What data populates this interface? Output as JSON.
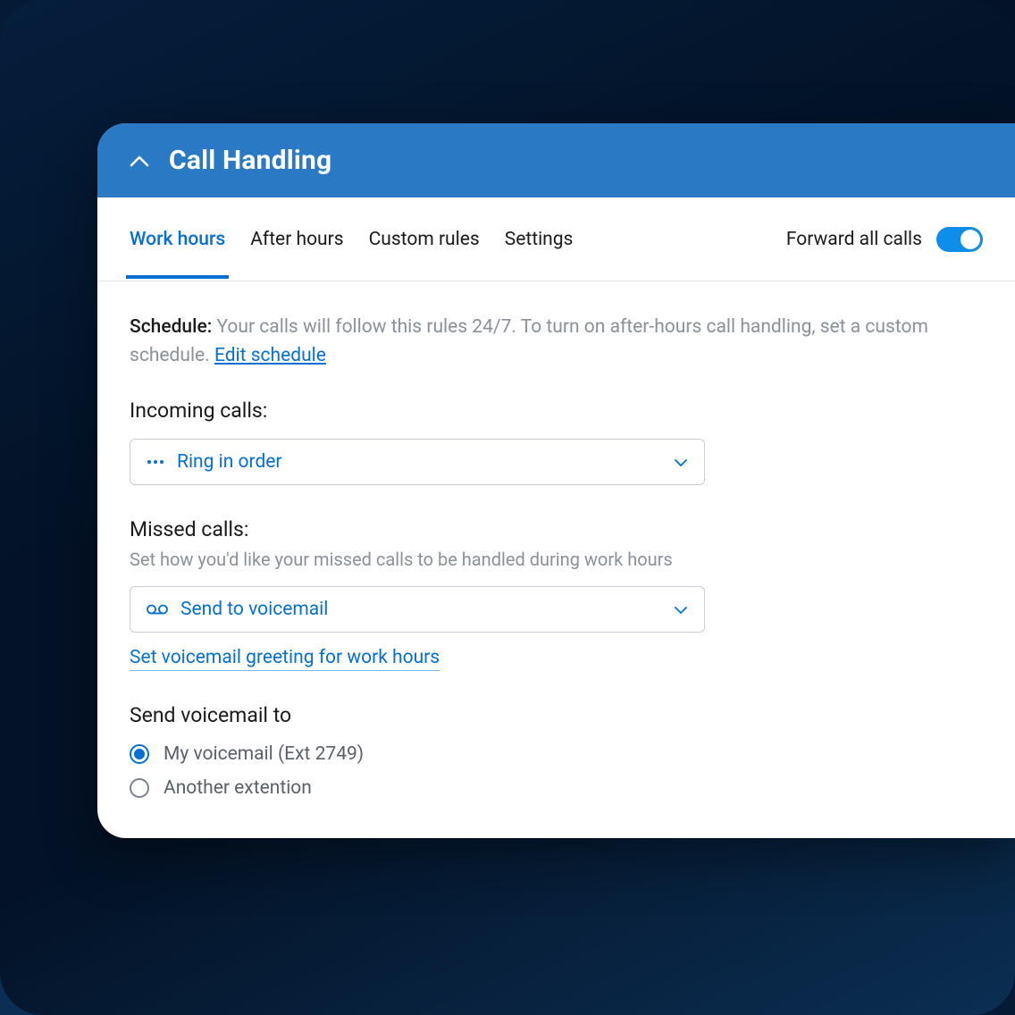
{
  "panel": {
    "title": "Call Handling"
  },
  "tabs": [
    {
      "label": "Work hours",
      "active": true
    },
    {
      "label": "After hours",
      "active": false
    },
    {
      "label": "Custom rules",
      "active": false
    },
    {
      "label": "Settings",
      "active": false
    }
  ],
  "forward_toggle": {
    "label": "Forward all calls",
    "on": true
  },
  "schedule": {
    "label": "Schedule:",
    "desc": "Your calls will follow this rules 24/7. To turn on after-hours call handling, set a custom schedule.",
    "link": "Edit schedule"
  },
  "incoming": {
    "title": "Incoming calls:",
    "select_value": "Ring in order",
    "icon": "more-horizontal-icon"
  },
  "missed": {
    "title": "Missed calls:",
    "desc": "Set how you'd like your missed calls to be handled during work hours",
    "select_value": "Send to voicemail",
    "icon": "voicemail-icon",
    "greeting_link": "Set voicemail greeting for work hours"
  },
  "voicemail_to": {
    "title": "Send voicemail to",
    "options": [
      {
        "label": "My voicemail (Ext 2749)",
        "selected": true
      },
      {
        "label": "Another extention",
        "selected": false
      }
    ]
  },
  "colors": {
    "accent": "#066fd1",
    "header": "#2979c4"
  }
}
